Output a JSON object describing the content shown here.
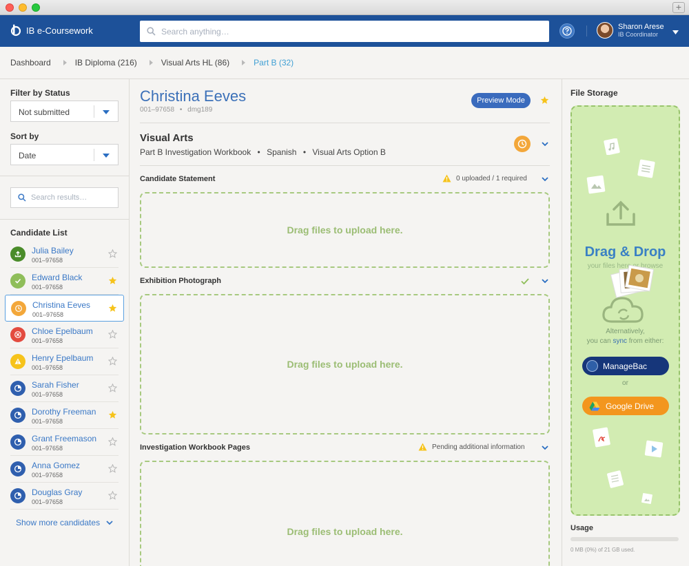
{
  "app": {
    "name": "IB e-Coursework",
    "search_placeholder": "Search anything…",
    "user": {
      "name": "Sharon Arese",
      "role": "IB Coordinator"
    }
  },
  "breadcrumb": [
    "Dashboard",
    "IB Diploma (216)",
    "Visual Arts HL (86)",
    "Part B (32)"
  ],
  "sidebar": {
    "filter_label": "Filter by Status",
    "filter_value": "Not submitted",
    "sort_label": "Sort by",
    "sort_value": "Date",
    "search_placeholder": "Search results…",
    "list_title": "Candidate List",
    "candidates": [
      {
        "name": "Julia Bailey",
        "id": "001–97658",
        "status": "uploaded",
        "color": "#4a8c2a",
        "starred": false
      },
      {
        "name": "Edward Black",
        "id": "001–97658",
        "status": "complete",
        "color": "#8fbe5a",
        "starred": true
      },
      {
        "name": "Christina Eeves",
        "id": "001–97658",
        "status": "pending",
        "color": "#f3a73a",
        "starred": true
      },
      {
        "name": "Chloe Epelbaum",
        "id": "001–97658",
        "status": "error",
        "color": "#e34b3f",
        "starred": false
      },
      {
        "name": "Henry Epelbaum",
        "id": "001–97658",
        "status": "warning",
        "color": "#f6c31b",
        "starred": false
      },
      {
        "name": "Sarah Fisher",
        "id": "001–97658",
        "status": "progress",
        "color": "#2f5fae",
        "starred": false
      },
      {
        "name": "Dorothy Freeman",
        "id": "001–97658",
        "status": "progress",
        "color": "#2f5fae",
        "starred": true
      },
      {
        "name": "Grant Freemason",
        "id": "001–97658",
        "status": "progress",
        "color": "#2f5fae",
        "starred": false
      },
      {
        "name": "Anna Gomez",
        "id": "001–97658",
        "status": "progress",
        "color": "#2f5fae",
        "starred": false
      },
      {
        "name": "Douglas Gray",
        "id": "001–97658",
        "status": "progress",
        "color": "#2f5fae",
        "starred": false
      }
    ],
    "show_more": "Show more candidates"
  },
  "main": {
    "student_name": "Christina Eeves",
    "student_id": "001–97658",
    "student_code": "dmg189",
    "preview_label": "Preview Mode",
    "subject": "Visual Arts",
    "subject_details": [
      "Part B Investigation Workbook",
      "Spanish",
      "Visual Arts Option B"
    ],
    "sections": [
      {
        "title": "Candidate Statement",
        "status": "0 uploaded / 1 required",
        "drop": "Drag files to upload here."
      },
      {
        "title": "Exhibition Photograph",
        "status": "",
        "drop": "Drag files to upload here."
      },
      {
        "title": "Investigation Workbook Pages",
        "status": "Pending additional information",
        "drop": "Drag files to upload here."
      }
    ]
  },
  "storage": {
    "title": "File Storage",
    "drag_title": "Drag & Drop",
    "drag_sub": "your files here or browse",
    "alt_line1": "Alternatively,",
    "alt_line2_a": "you can ",
    "alt_line2_sync": "sync",
    "alt_line2_b": " from either:",
    "managebac": "ManageBac",
    "or": "or",
    "gdrive": "Google Drive",
    "usage_label": "Usage",
    "usage_text": "0 MB (0%) of 21 GB used.",
    "usage_fraction": 0
  },
  "colors": {
    "brand": "#1d5199",
    "accent": "#3a78c6",
    "drop": "#a7c97f",
    "star": "#f6c31b"
  }
}
